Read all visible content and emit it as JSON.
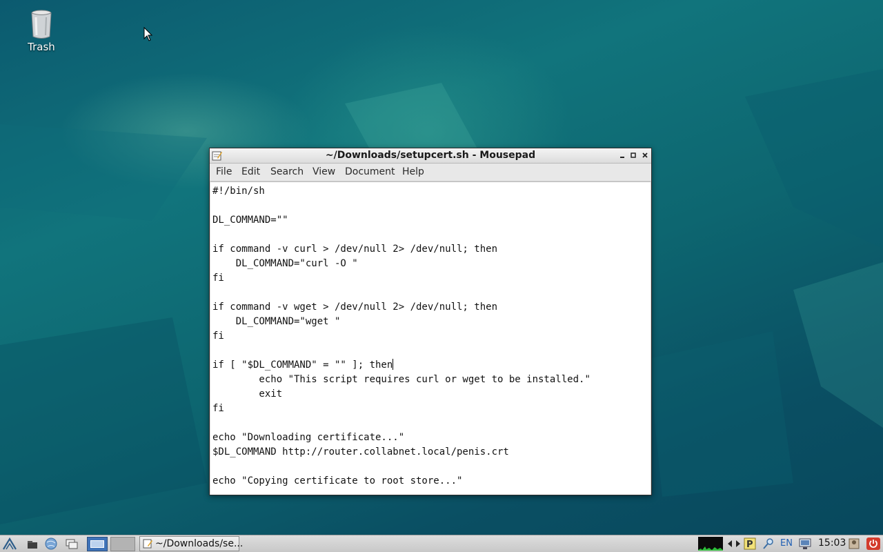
{
  "desktop": {
    "icons": [
      {
        "label": "Trash"
      }
    ]
  },
  "window": {
    "title": "~/Downloads/setupcert.sh - Mousepad",
    "menu": [
      "File",
      "Edit",
      "Search",
      "View",
      "Document",
      "Help"
    ],
    "editor": {
      "lines": [
        "#!/bin/sh",
        "",
        "DL_COMMAND=\"\"",
        "",
        "if command -v curl > /dev/null 2> /dev/null; then",
        "    DL_COMMAND=\"curl -O \"",
        "fi",
        "",
        "if command -v wget > /dev/null 2> /dev/null; then",
        "    DL_COMMAND=\"wget \"",
        "fi",
        "",
        "if [ \"$DL_COMMAND\" = \"\" ]; then",
        "        echo \"This script requires curl or wget to be installed.\"",
        "        exit",
        "fi",
        "",
        "echo \"Downloading certificate...\"",
        "$DL_COMMAND http://router.collabnet.local/penis.crt",
        "",
        "echo \"Copying certificate to root store...\""
      ],
      "caret_line": 12
    }
  },
  "taskbar": {
    "task_window_label": "~/Downloads/se...",
    "language": "EN",
    "clock": "15:03"
  },
  "colors": {
    "desktop_base": "#0b5a6f",
    "titlebar": "#dcdcdc",
    "taskbar": "#c7c7c7",
    "lang_text": "#1f5fb4"
  }
}
